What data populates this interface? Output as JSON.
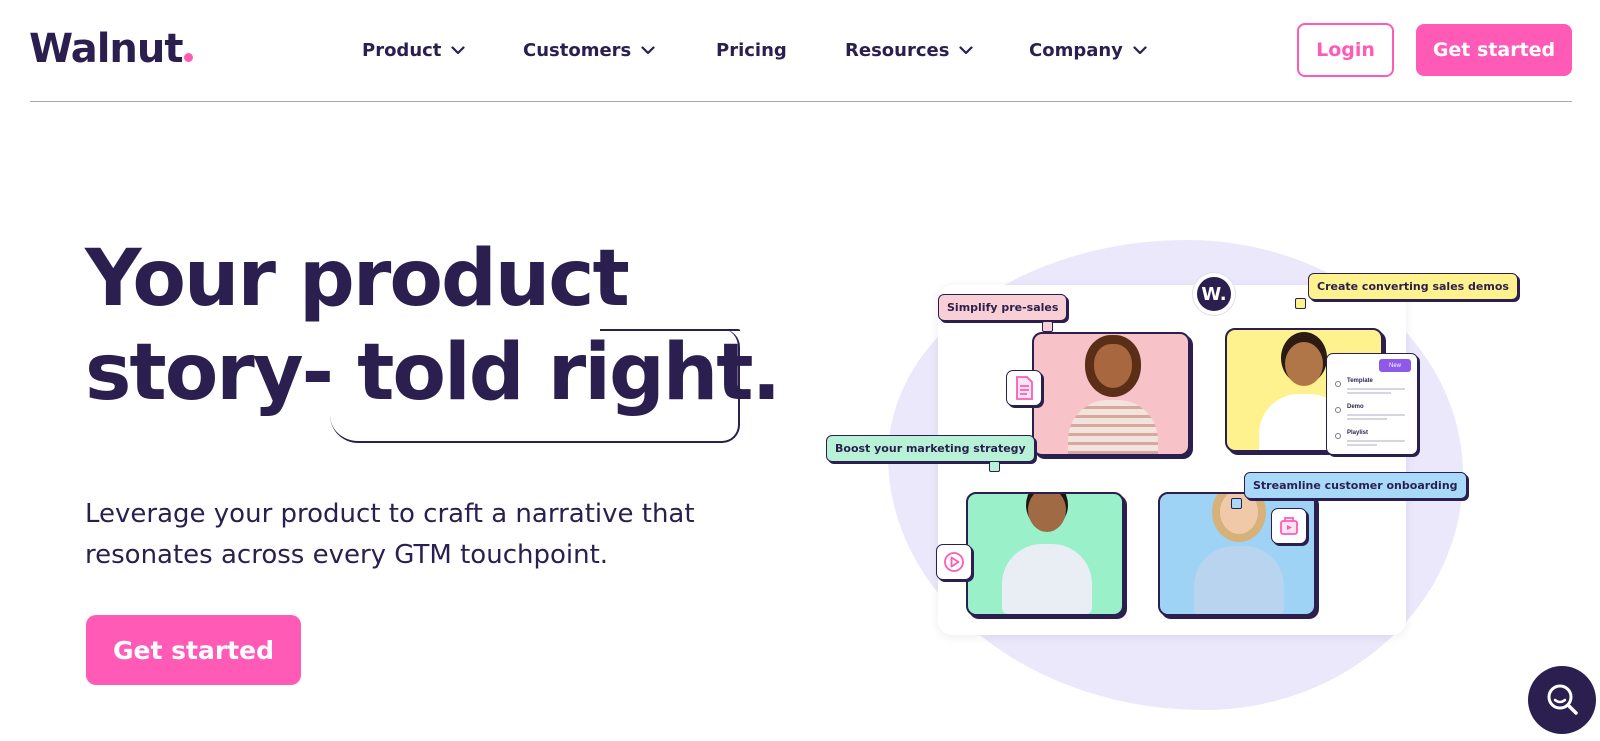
{
  "brand": {
    "logo_text": "Walnut",
    "accent": "#ff5bb6",
    "dark": "#2a1f4f"
  },
  "nav": {
    "items": [
      {
        "label": "Product",
        "has_dropdown": true
      },
      {
        "label": "Customers",
        "has_dropdown": true
      },
      {
        "label": "Pricing",
        "has_dropdown": false
      },
      {
        "label": "Resources",
        "has_dropdown": true
      },
      {
        "label": "Company",
        "has_dropdown": true
      }
    ],
    "login_label": "Login",
    "cta_label": "Get started"
  },
  "hero": {
    "headline_line1": "Your product",
    "headline_line2": "story- told right.",
    "subtext": "Leverage your product to craft a narrative that resonates across every GTM touchpoint.",
    "cta_label": "Get started"
  },
  "illustration": {
    "badge": "W.",
    "tags": {
      "presales": "Simplify pre-sales",
      "sales": "Create converting sales demos",
      "marketing": "Boost your marketing strategy",
      "onboarding": "Streamline customer onboarding"
    },
    "mini_panel": {
      "new_label": "New",
      "rows": [
        "Template",
        "Demo",
        "Playlist"
      ]
    },
    "icons": [
      "document-icon",
      "play-icon",
      "folder-icon"
    ]
  },
  "search_fab": {
    "icon": "search-icon"
  }
}
